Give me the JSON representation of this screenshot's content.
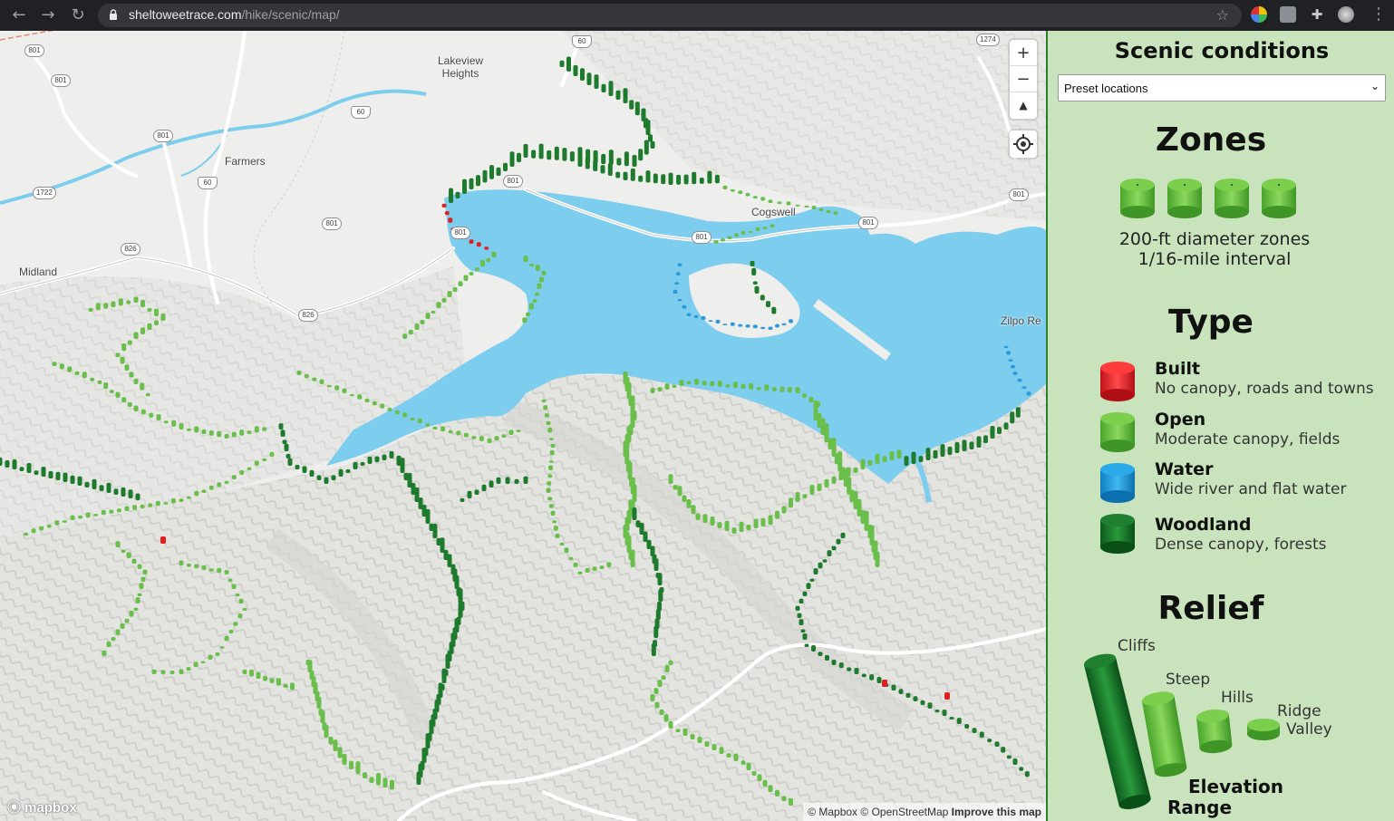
{
  "browser": {
    "url_host": "sheltoweetrace.com",
    "url_path": "/hike/scenic/map/",
    "icons": [
      "back-arrow-icon",
      "forward-arrow-icon",
      "reload-icon",
      "lock-icon",
      "star-icon",
      "extensions-icon",
      "menu-icon"
    ]
  },
  "map": {
    "places": {
      "lakeview": "Lakeview\nHeights",
      "farmers": "Farmers",
      "midland": "Midland",
      "cogswell": "Cogswell",
      "zilpo": "Zilpo Re"
    },
    "shields": {
      "s801a": "801",
      "s801b": "801",
      "s801c": "801",
      "s801d": "801",
      "s801e": "801",
      "s801f": "801",
      "s801g": "801",
      "s801h": "801",
      "s801i": "801",
      "s60a": "60",
      "s60b": "60",
      "s60c": "60",
      "s1722": "1722",
      "s826a": "826",
      "s826b": "826",
      "s1274": "1274",
      "s826c": "826"
    },
    "controls": {
      "zoom_in": "+",
      "zoom_out": "−",
      "compass": "▲"
    },
    "logo": "mapbox",
    "attribution": {
      "mapbox": "© Mapbox",
      "osm": "© OpenStreetMap",
      "improve": "Improve this map"
    },
    "colors": {
      "water": "#7dcdee",
      "built": "#e02020",
      "open": "#6abf4b",
      "water_zone": "#2a9bd8",
      "woodland": "#1e7a2c"
    }
  },
  "panel": {
    "title": "Scenic conditions",
    "preset_select": {
      "selected": "Preset locations"
    },
    "zones": {
      "heading": "Zones",
      "line1": "200-ft diameter zones",
      "line2": "1/16-mile interval"
    },
    "type": {
      "heading": "Type",
      "items": [
        {
          "name": "Built",
          "desc": "No canopy, roads and towns",
          "color": "#e8232a"
        },
        {
          "name": "Open",
          "desc": "Moderate canopy, fields",
          "color": "#62bf3c"
        },
        {
          "name": "Water",
          "desc": "Wide river and flat water",
          "color": "#1a9ee0"
        },
        {
          "name": "Woodland",
          "desc": "Dense canopy, forests",
          "color": "#13702a"
        }
      ]
    },
    "relief": {
      "heading": "Relief",
      "labels": {
        "cliffs": "Cliffs",
        "steep": "Steep",
        "hills": "Hills",
        "ridge": "Ridge",
        "valley": "Valley"
      },
      "elevation": "Elevation",
      "range": "Range"
    }
  }
}
